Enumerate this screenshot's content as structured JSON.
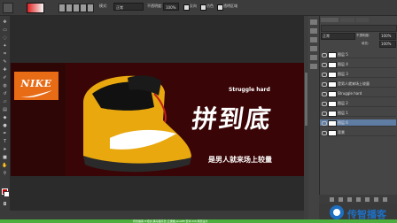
{
  "options_bar": {
    "mode_label": "模式:",
    "mode_value": "正常",
    "opacity_label": "不透明度:",
    "opacity_value": "100%",
    "reverse_label": "反向",
    "dither_label": "仿色",
    "transparency_label": "透明区域"
  },
  "layers_panel": {
    "blend_value": "正常",
    "opacity_label": "不透明度:",
    "opacity_value": "100%",
    "fill_label": "填充:",
    "fill_value": "100%",
    "layers": [
      {
        "name": "图层 5",
        "selected": false
      },
      {
        "name": "图层 4",
        "selected": false
      },
      {
        "name": "图层 3",
        "selected": false
      },
      {
        "name": "是男人就来场上较量",
        "selected": false
      },
      {
        "name": "Struggle hard",
        "selected": false
      },
      {
        "name": "图层 2",
        "selected": false
      },
      {
        "name": "图层 1",
        "selected": false
      },
      {
        "name": "图层 6",
        "selected": true
      },
      {
        "name": "背景",
        "selected": false
      }
    ]
  },
  "canvas": {
    "logo_text": "NIKE",
    "slogan_en": "Struggle hard",
    "slogan_big": "拼到底",
    "slogan_cn": "是男人就来场上较量"
  },
  "branding": {
    "name": "传智播客"
  },
  "bottom_bar": {
    "text": "传智播客 IT培训 黑马程序员 云课堂 JavaEE 安卓 iOS 网页设计"
  },
  "colors": {
    "foreground": "#d00000",
    "background": "#ffffff",
    "accent": "#1e6fc2",
    "canvas_bg": "#3a0506"
  }
}
